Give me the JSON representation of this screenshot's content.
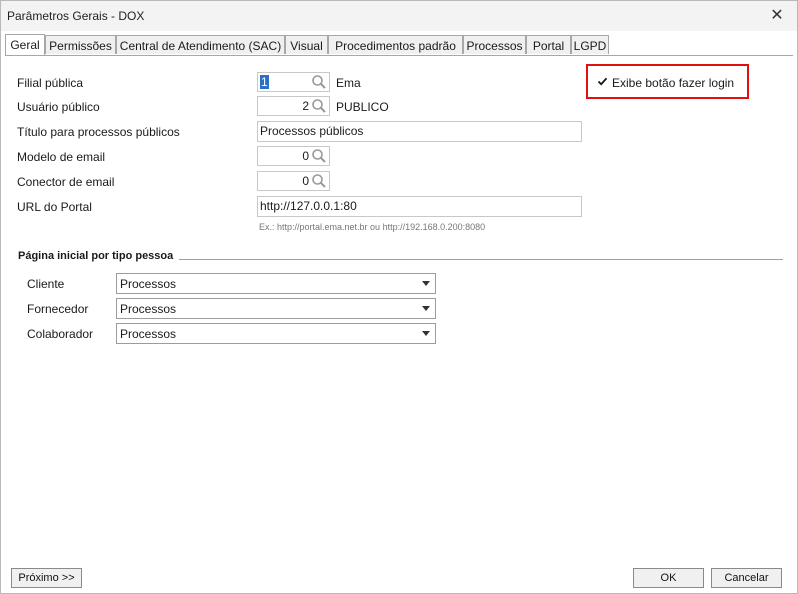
{
  "window": {
    "title": "Parâmetros Gerais - DOX",
    "close_icon": "close-icon"
  },
  "tabs": [
    {
      "label": "Geral",
      "active": true
    },
    {
      "label": "Permissões"
    },
    {
      "label": "Central de Atendimento (SAC)"
    },
    {
      "label": "Visual"
    },
    {
      "label": "Procedimentos padrão"
    },
    {
      "label": "Processos"
    },
    {
      "label": "Portal"
    },
    {
      "label": "LGPD"
    }
  ],
  "form": {
    "filial_publica": {
      "label": "Filial pública",
      "value": "1",
      "description": "Ema"
    },
    "usuario_publico": {
      "label": "Usuário público",
      "value": "2",
      "description": "PUBLICO"
    },
    "titulo_processos": {
      "label": "Título para processos públicos",
      "value": "Processos públicos"
    },
    "modelo_email": {
      "label": "Modelo de email",
      "value": "0"
    },
    "conector_email": {
      "label": "Conector de email",
      "value": "0"
    },
    "url_portal": {
      "label": "URL do Portal",
      "value": "http://127.0.0.1:80",
      "hint": "Ex.: http://portal.ema.net.br ou http://192.168.0.200:8080"
    },
    "exibe_login": {
      "label": "Exibe botão fazer login",
      "checked": true
    }
  },
  "pagina_inicial": {
    "title": "Página inicial por tipo pessoa",
    "rows": [
      {
        "label": "Cliente",
        "value": "Processos"
      },
      {
        "label": "Fornecedor",
        "value": "Processos"
      },
      {
        "label": "Colaborador",
        "value": "Processos"
      }
    ]
  },
  "footer": {
    "next_label": "Próximo >>",
    "ok_label": "OK",
    "cancel_label": "Cancelar"
  },
  "colors": {
    "highlight": "#e20f0f",
    "selection": "#2c6fc9"
  }
}
